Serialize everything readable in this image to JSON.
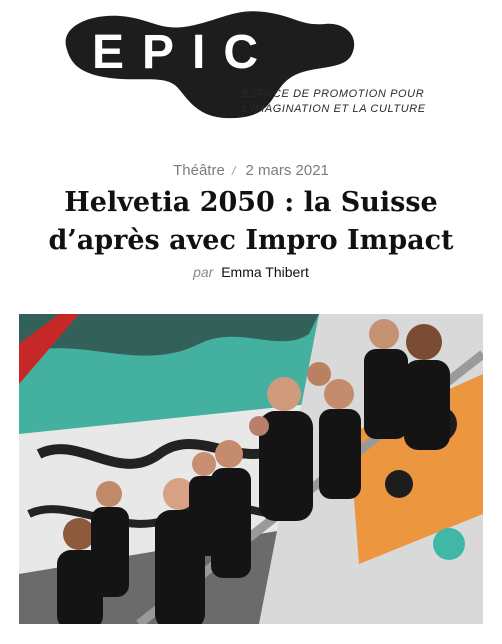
{
  "site": {
    "logo_text": "EPIC",
    "tagline_line1": "ESPACE DE PROMOTION POUR",
    "tagline_line2": "L'IMAGINATION ET LA CULTURE"
  },
  "article": {
    "category": "Théâtre",
    "separator": "/",
    "date": "2 mars 2021",
    "title_line1": "Helvetia 2050 : la Suisse",
    "title_line2": "d’après avec Impro Impact",
    "byline_prefix": "par",
    "author": "Emma Thibert"
  },
  "colors": {
    "logo_blob": "#1d1d1d",
    "title": "#111111",
    "meta": "#7d7d7d",
    "graffiti_teal": "#3fb8a6",
    "graffiti_orange": "#f08a24"
  },
  "image": {
    "icon": "group-photo-graffiti"
  }
}
